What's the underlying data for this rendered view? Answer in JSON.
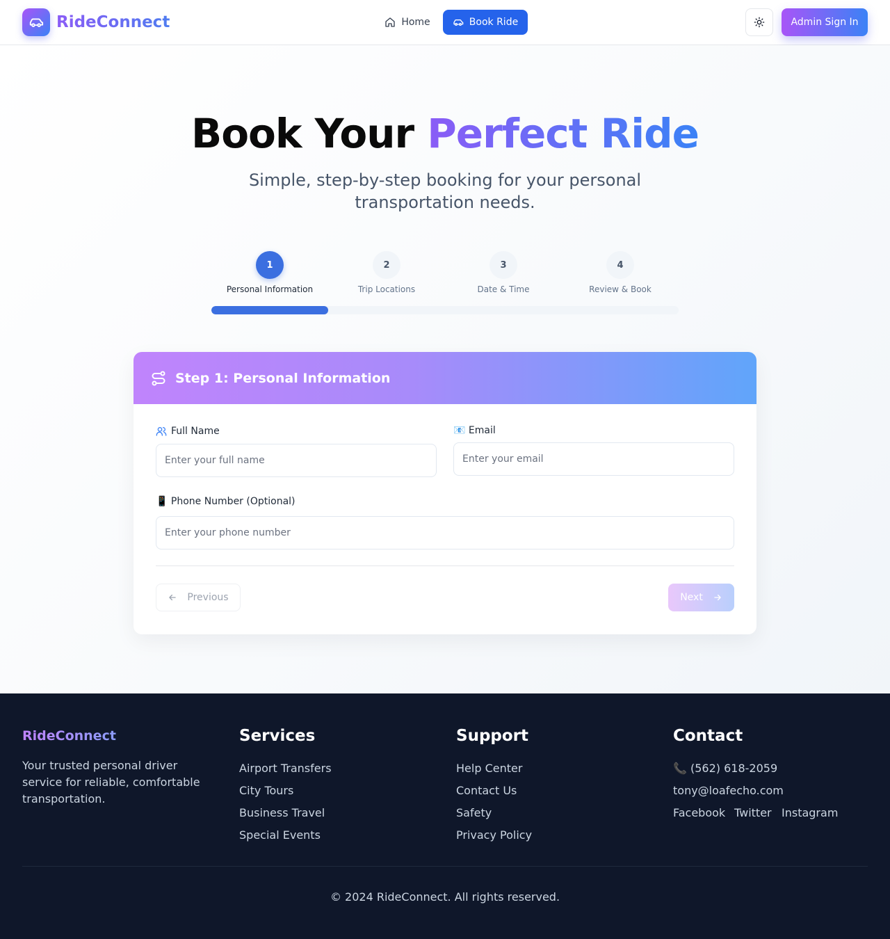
{
  "header": {
    "brand": "RideConnect",
    "nav": {
      "home": "Home",
      "book_ride": "Book Ride"
    },
    "admin_sign_in": "Admin Sign In"
  },
  "hero": {
    "title_plain": "Book Your ",
    "title_highlight": "Perfect Ride",
    "subtitle": "Simple, step-by-step booking for your personal transportation needs."
  },
  "steps": [
    {
      "number": "1",
      "label": "Personal Information",
      "active": true
    },
    {
      "number": "2",
      "label": "Trip Locations",
      "active": false
    },
    {
      "number": "3",
      "label": "Date & Time",
      "active": false
    },
    {
      "number": "4",
      "label": "Review & Book",
      "active": false
    }
  ],
  "progress": {
    "current_step": 1,
    "total_steps": 4,
    "fraction": 0.25
  },
  "form": {
    "title": "Step 1: Personal Information",
    "full_name": {
      "label": "Full Name",
      "placeholder": "Enter your full name",
      "value": ""
    },
    "email": {
      "label": "📧 Email",
      "placeholder": "Enter your email",
      "value": ""
    },
    "phone": {
      "label": "📱 Phone Number (Optional)",
      "placeholder": "Enter your phone number",
      "value": ""
    },
    "previous": "Previous",
    "next": "Next"
  },
  "footer": {
    "brand": "RideConnect",
    "tagline": "Your trusted personal driver service for reliable, comfortable transportation.",
    "services": {
      "title": "Services",
      "items": [
        "Airport Transfers",
        "City Tours",
        "Business Travel",
        "Special Events"
      ]
    },
    "support": {
      "title": "Support",
      "items": [
        "Help Center",
        "Contact Us",
        "Safety",
        "Privacy Policy"
      ]
    },
    "contact": {
      "title": "Contact",
      "phone": "📞 (562) 618-2059",
      "email": "tony@loafecho.com",
      "social": [
        "Facebook",
        "Twitter",
        "Instagram"
      ]
    },
    "copyright": "© 2024 RideConnect. All rights reserved."
  },
  "colors": {
    "primary": "#2563eb",
    "accent_purple": "#a855f7",
    "accent_blue": "#3b82f6",
    "footer_bg": "#0f172a"
  },
  "icons": {
    "logo": "car-icon",
    "home": "home-icon",
    "book": "car-icon",
    "theme": "sun-icon",
    "form_header": "route-icon",
    "full_name": "user-icon",
    "previous": "arrow-left-icon",
    "next": "arrow-right-icon"
  }
}
